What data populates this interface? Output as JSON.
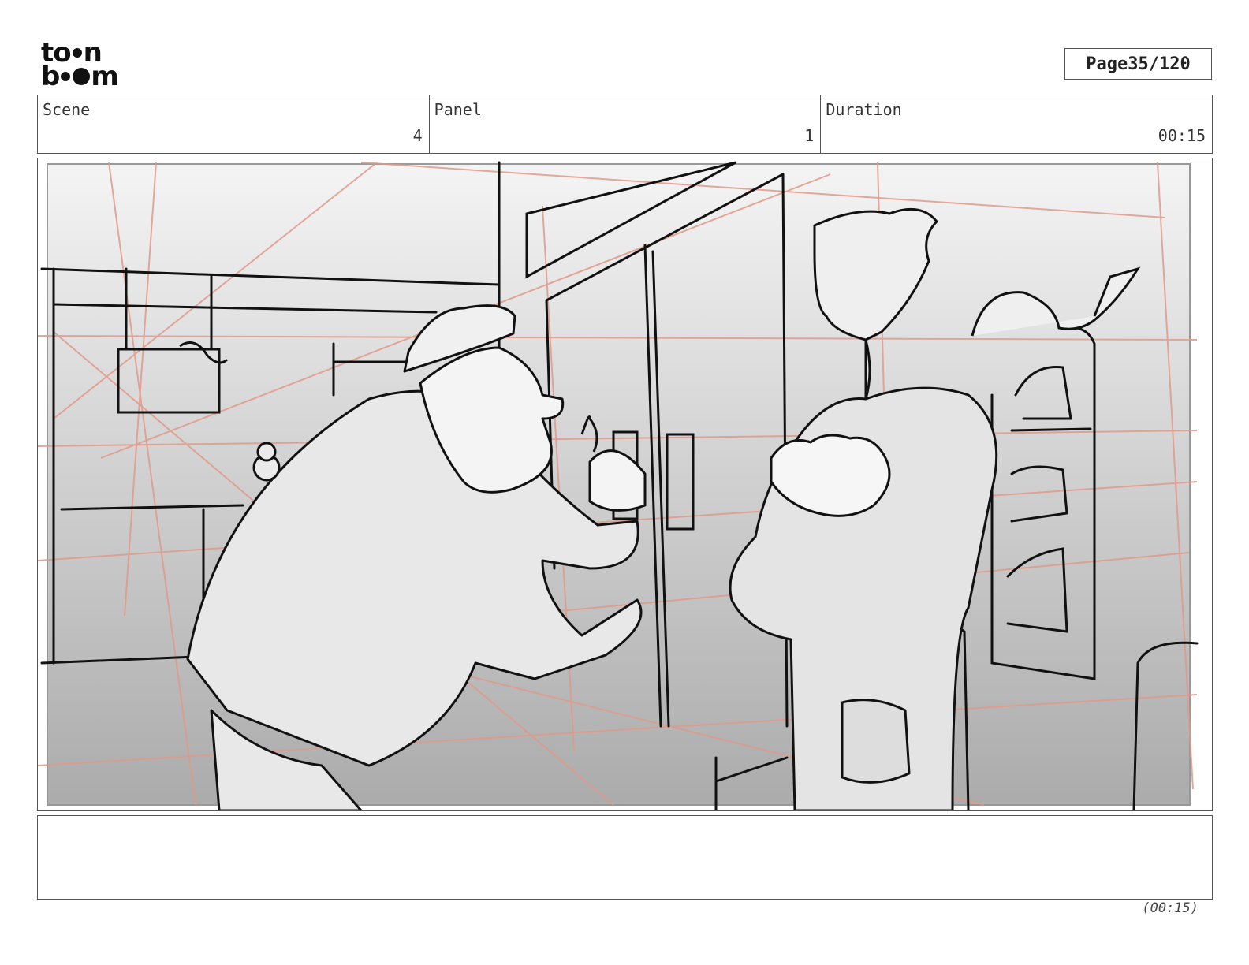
{
  "brand": {
    "logo_name": "toon boom",
    "line1": "to",
    "line1b": "n",
    "line2a": "b",
    "line2b": "m"
  },
  "header": {
    "page_label": "Page",
    "page_value": "35/120"
  },
  "info": {
    "scene_label": "Scene",
    "scene_value": "4",
    "panel_label": "Panel",
    "panel_value": "1",
    "duration_label": "Duration",
    "duration_value": "00:15"
  },
  "notes": {
    "text": ""
  },
  "footer": {
    "duration": "(00:15)"
  }
}
